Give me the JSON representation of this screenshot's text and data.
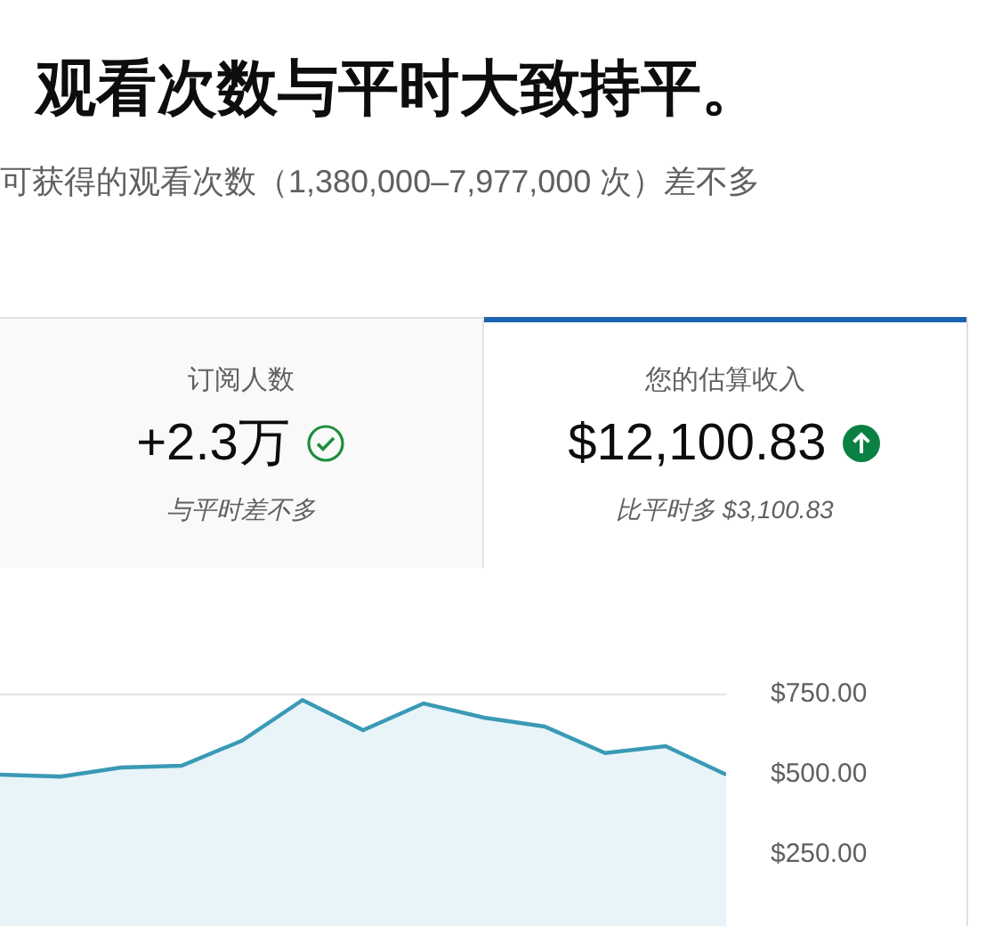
{
  "headline": "观看次数与平时大致持平。",
  "subtitle": "可获得的观看次数（1,380,000–7,977,000 次）差不多",
  "metrics": [
    {
      "label": "订阅人数",
      "value": "+2.3万",
      "kind": "check",
      "note": "与平时差不多",
      "selected": false
    },
    {
      "label": "您的估算收入",
      "value": "$12,100.83",
      "kind": "up",
      "note": "比平时多 $3,100.83",
      "selected": true
    }
  ],
  "chart": {
    "chart_data": {
      "type": "area",
      "ylim": [
        0,
        750
      ],
      "yticks": [
        {
          "value": 750,
          "label": "$750.00"
        },
        {
          "value": 500,
          "label": "$500.00"
        },
        {
          "value": 250,
          "label": "$250.00"
        }
      ],
      "series": [
        {
          "color": "#3a9ab5",
          "values": [
            500,
            494,
            522,
            528,
            606,
            733,
            639,
            722,
            678,
            650,
            567,
            589,
            500
          ]
        }
      ]
    }
  }
}
